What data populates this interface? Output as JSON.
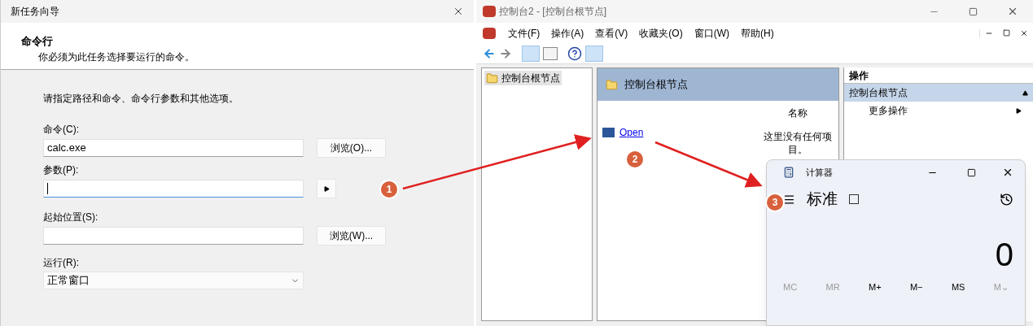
{
  "wizard": {
    "title": "新任务向导",
    "heading": "命令行",
    "subheading": "你必须为此任务选择要运行的命令。",
    "instruction": "请指定路径和命令、命令行参数和其他选项。",
    "command": {
      "label": "命令(C):",
      "value": "calc.exe",
      "button": "浏览(O)..."
    },
    "arguments": {
      "label": "参数(P):",
      "focused": true
    },
    "start_in": {
      "label": "起始位置(S):",
      "button": "浏览(W)..."
    },
    "run": {
      "label": "运行(R):",
      "value": "正常窗口"
    }
  },
  "console": {
    "title": "控制台2 - [控制台根节点]",
    "menu": [
      "文件(F)",
      "操作(A)",
      "查看(V)",
      "收藏夹(O)",
      "窗口(W)",
      "帮助(H)"
    ],
    "tree": [
      {
        "label": "控制台根节点",
        "selected": true
      }
    ],
    "middle": {
      "header": "控制台根节点",
      "column": "名称",
      "link": "Open",
      "empty_text": "这里没有任何项目。"
    },
    "actions": {
      "title": "操作",
      "section": "控制台根节点",
      "expanded": true,
      "item": "更多操作"
    }
  },
  "calculator": {
    "title": "计算器",
    "mode": "标准",
    "display": "0",
    "memory": [
      {
        "label": "MC",
        "disabled": true
      },
      {
        "label": "MR",
        "disabled": true
      },
      {
        "label": "M+",
        "disabled": false
      },
      {
        "label": "M−",
        "disabled": false
      },
      {
        "label": "MS",
        "disabled": false
      },
      {
        "label": "M⌄",
        "disabled": true
      }
    ]
  },
  "annotations": [
    "1",
    "2",
    "3"
  ]
}
